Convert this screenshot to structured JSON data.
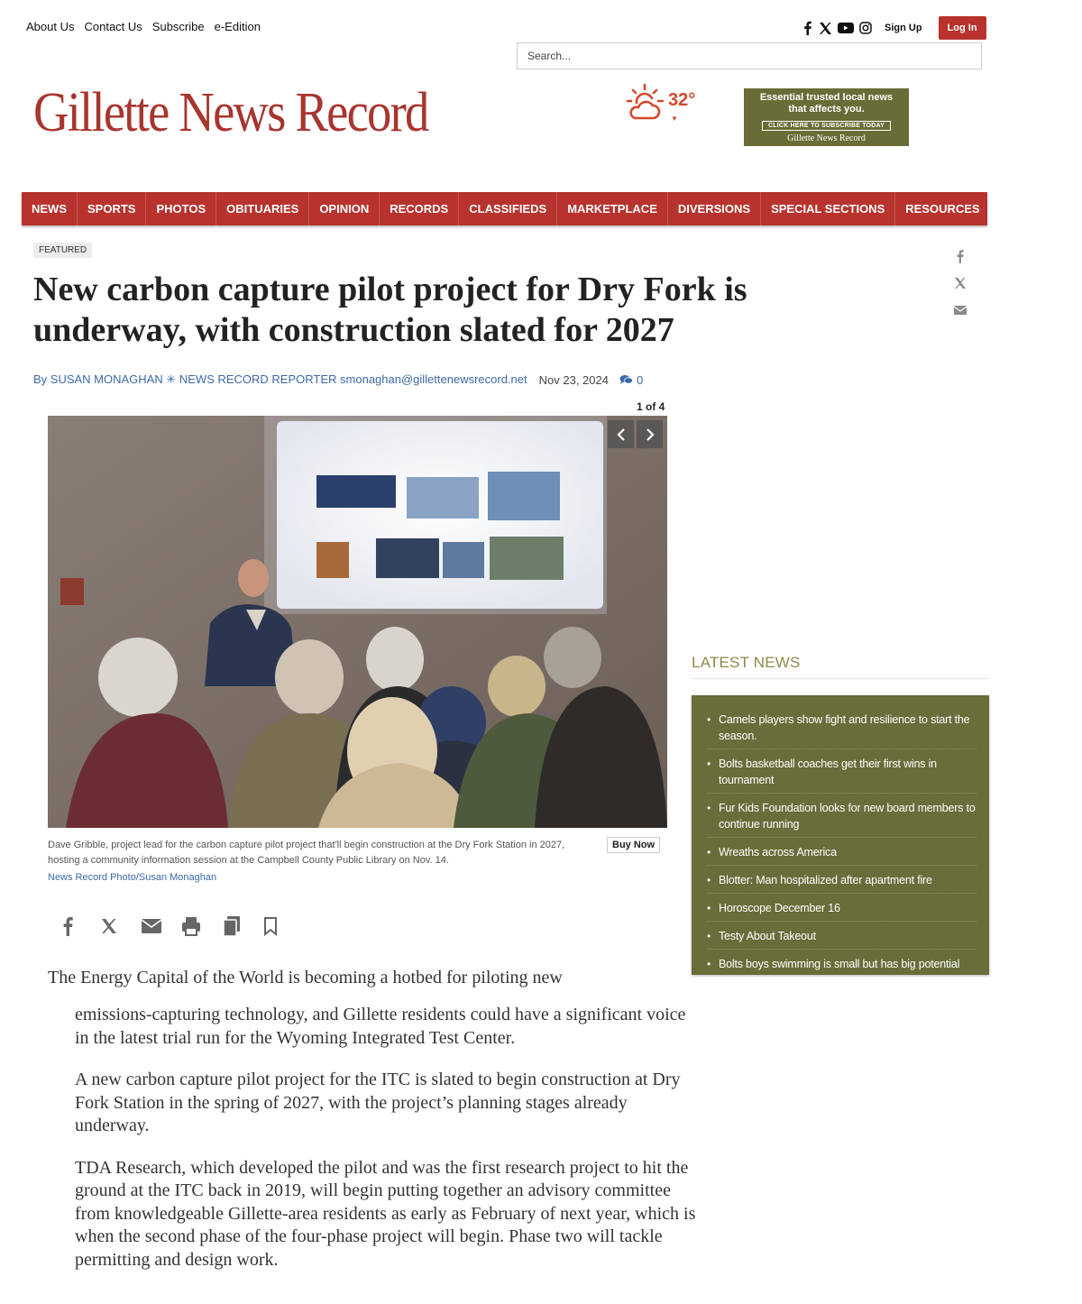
{
  "utility_nav": [
    "About Us",
    "Contact Us",
    "Subscribe",
    "e-Edition"
  ],
  "account": {
    "signup": "Sign Up",
    "login": "Log In"
  },
  "search": {
    "placeholder": "Search..."
  },
  "masthead": {
    "title": "Gillette News Record"
  },
  "weather": {
    "temp": "32°",
    "icon": "partly-sunny-icon"
  },
  "ad": {
    "line1": "Essential trusted local news",
    "line2": "that affects you.",
    "cta": "CLICK HERE TO SUBSCRIBE TODAY",
    "logo": "Gillette News Record"
  },
  "nav": [
    "NEWS",
    "SPORTS",
    "PHOTOS",
    "OBITUARIES",
    "OPINION",
    "RECORDS",
    "CLASSIFIEDS",
    "MARKETPLACE",
    "DIVERSIONS",
    "SPECIAL SECTIONS",
    "RESOURCES"
  ],
  "article": {
    "badge": "FEATURED",
    "headline": "New carbon capture pilot project for Dry Fork is underway, with construction slated for 2027",
    "byline": "By SUSAN MONAGHAN ✳ NEWS RECORD REPORTER smonaghan@gillettenewsrecord.net",
    "date": "Nov 23, 2024",
    "comment_count": "0",
    "gallery": {
      "counter": "1 of 4",
      "caption": "Dave Gribble, project lead for the carbon capture pilot project that'll begin construction at the Dry Fork Station in 2027, hosting a community information session at the Campbell County Public Library on Nov. 14.",
      "credit": "News Record Photo/Susan Monaghan",
      "buy_now": "Buy Now"
    },
    "first_line": "The Energy Capital of the World is becoming a hotbed for piloting new",
    "paragraphs": [
      "emissions-capturing technology, and Gillette residents could have a significant voice in the latest trial run for the Wyoming Integrated Test Center.",
      "A new carbon capture pilot project for the ITC is slated to begin construction at Dry Fork Station in the spring of 2027, with the project’s planning stages already underway.",
      "TDA Research, which developed the pilot and was the first research project to hit the ground at the ITC back in 2019, will begin putting together an advisory committee from knowledgeable Gillette-area residents as early as February of next year, which is when the second phase of the four-phase project will begin. Phase two will tackle permitting and design work."
    ]
  },
  "sidebar": {
    "latest_title": "LATEST NEWS",
    "items": [
      "Camels players show fight and resilience to start the season.",
      "Bolts basketball coaches get their first wins in tournament",
      "Fur Kids Foundation looks for new board members to continue running",
      "Wreaths across America",
      "Blotter: Man hospitalized after apartment fire",
      "Horoscope December 16",
      "Testy About Takeout",
      "Bolts boys swimming is small but has big potential"
    ]
  },
  "colors": {
    "brand_red": "#b8332d",
    "sidebar_olive": "#6a6c3a",
    "link_blue": "#3c6aa8",
    "weather_orange": "#d5492b"
  }
}
